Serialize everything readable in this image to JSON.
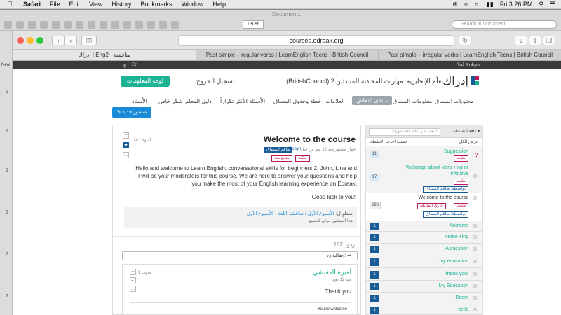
{
  "menubar": {
    "app": "Safari",
    "items": [
      "File",
      "Edit",
      "View",
      "History",
      "Bookmarks",
      "Window",
      "Help"
    ],
    "clock": "Fri 3:26 PM"
  },
  "doc": {
    "title": "Document1",
    "zoom": "130%",
    "search_placeholder": "Search in Document",
    "new_label": "New",
    "line_numbers": [
      "1",
      "1",
      "1",
      "2",
      "2",
      "2"
    ]
  },
  "browser": {
    "url": "courses.edraak.org",
    "tabs": [
      {
        "label": "إدراك | Eng2 - مناقشة",
        "active": true
      },
      {
        "label": "Past simple – regular verbs | LearnEnglish Teens | British Council",
        "active": false
      },
      {
        "label": "Past simple – irregular verbs | LearnEnglish Teens | British Council",
        "active": false
      }
    ]
  },
  "site": {
    "lang_ar": "ع",
    "lang_en": "En",
    "greeting": "أهلاً Robyn",
    "dashboard_button": "لوحة المعلومات",
    "logout": "تسجيل الخروج",
    "course_title": "(BritishCouncil) تعلّم الإنجليزية: مهارات المحادثة للمبتدئين 2",
    "logo_word": "إدراك",
    "logo_sub": "EDRAAK",
    "nav": [
      {
        "label": "محتويات المساق",
        "active": false
      },
      {
        "label": "معلومات المساق",
        "active": false
      },
      {
        "label": "منتدى النقاش",
        "active": true
      },
      {
        "label": "العلامات",
        "active": false
      },
      {
        "label": "خطة وجدول المساق",
        "active": false
      },
      {
        "label": "الأسئلة الأكثر تكراراً",
        "active": false
      },
      {
        "label": "دليل المعلم",
        "active": false
      },
      {
        "label": "شكر خاص",
        "active": false
      },
      {
        "label": "الأستاذ",
        "active": false
      }
    ],
    "new_post": "منشور جديد"
  },
  "post": {
    "title": "Welcome to the course",
    "votes": "28 أصوات",
    "staff_badge": "طاقم المساق",
    "author": "Robyn",
    "ago": "حوار منشور منذ 12 يوم من قبل",
    "pills": [
      "مثبّت",
      "متابع منه"
    ],
    "body": "Hello and welcome to Learn English: conversational skills for beginners 2. John, Lina and I will be your moderators for this course. We are here to answer your questions and help you make the most of your English learning experience on Edraak.",
    "closing": "Good luck to you!",
    "info_line1_prefix": "منطوٍ ل:",
    "info_line1_link": "الأسبوع الأول / مناقشة اللغة - الأسبوع الأول",
    "info_line2": "هذا المنشور مرئي للجميع",
    "replies": "182 ردود",
    "add_reply": "إضافة رد:"
  },
  "response": {
    "name": "أميرة الدقيشي",
    "ago": "منذ 12 يوم",
    "votes": "1 صوت",
    "text": "Thank you",
    "comment": "You're welcome"
  },
  "sidebar": {
    "filter_label": "كافة النقاشات",
    "search_placeholder": "البحث في كافة المنشورات",
    "show_all": "عرض الكل",
    "sort": "حسب أحدث الأنشطة",
    "threads": [
      {
        "title": "Suggestion",
        "count": "11",
        "count_style": "light",
        "gray": true,
        "q": "?",
        "pills": [
          {
            "text": "مثبّت",
            "style": "pink"
          }
        ]
      },
      {
        "title": "Webpage about Verb +ing or infinitive",
        "count": "17",
        "count_style": "light",
        "gray": true,
        "q": "",
        "pills": [
          {
            "text": "مثبّت",
            "style": "pink"
          },
          {
            "text": "بواسطة: طاقم المساق",
            "style": "blue"
          }
        ]
      },
      {
        "title": "Welcome to the course",
        "count": "296",
        "count_style": "plain",
        "gray": false,
        "q": "",
        "pills": [
          {
            "text": "مثبّت",
            "style": "pink"
          },
          {
            "text": "جاري المتابعة",
            "style": "pink"
          },
          {
            "text": "بواسطة: طاقم المساق",
            "style": "blue"
          }
        ]
      },
      {
        "title": "Answers",
        "count": "1",
        "count_style": "dark",
        "gray": true,
        "q": "",
        "pills": []
      },
      {
        "title": "verbe +ing",
        "count": "1",
        "count_style": "dark",
        "gray": true,
        "q": "",
        "pills": []
      },
      {
        "title": "A question",
        "count": "1",
        "count_style": "dark",
        "gray": true,
        "q": "",
        "pills": []
      },
      {
        "title": "my education",
        "count": "1",
        "count_style": "dark",
        "gray": true,
        "q": "",
        "pills": []
      },
      {
        "title": "thank you!",
        "count": "1",
        "count_style": "dark",
        "gray": true,
        "q": "",
        "pills": []
      },
      {
        "title": "My Education",
        "count": "1",
        "count_style": "dark",
        "gray": true,
        "q": "",
        "pills": []
      },
      {
        "title": "Reem",
        "count": "1",
        "count_style": "dark",
        "gray": true,
        "q": "",
        "pills": []
      },
      {
        "title": "hello",
        "count": "1",
        "count_style": "dark",
        "gray": true,
        "q": "",
        "pills": []
      }
    ]
  },
  "colors": {
    "accent": "#1ab394",
    "brand_blue": "#1a5c96",
    "pin_pink": "#c2185b"
  }
}
